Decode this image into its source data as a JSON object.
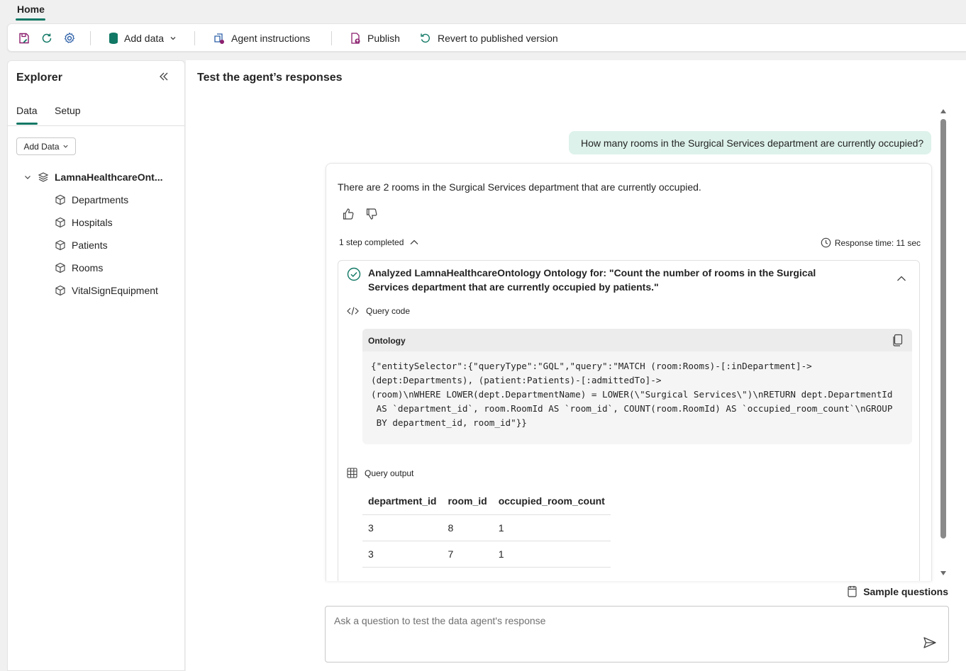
{
  "top_tab": {
    "label": "Home"
  },
  "toolbar": {
    "add_data_label": "Add data",
    "agent_instructions_label": "Agent instructions",
    "publish_label": "Publish",
    "revert_label": "Revert to published version"
  },
  "explorer": {
    "title": "Explorer",
    "tabs": [
      {
        "label": "Data"
      },
      {
        "label": "Setup"
      }
    ],
    "add_data_button": "Add Data",
    "tree_root": "LamnaHealthcareOnt...",
    "tree_items": [
      {
        "label": "Departments"
      },
      {
        "label": "Hospitals"
      },
      {
        "label": "Patients"
      },
      {
        "label": "Rooms"
      },
      {
        "label": "VitalSignEquipment"
      }
    ]
  },
  "main": {
    "title": "Test the agent’s responses",
    "user_message": "How many rooms in the Surgical Services department are currently occupied?",
    "response": {
      "text": "There are 2 rooms in the Surgical Services department that are currently occupied.",
      "steps_label": "1 step completed",
      "response_time": "Response time: 11 sec",
      "step": {
        "title": "Analyzed LamnaHealthcareOntology Ontology for: \"Count the number of rooms in the Surgical Services department that are currently occupied by patients.\"",
        "query_code_label": "Query code",
        "code_language": "Ontology",
        "code": "{\"entitySelector\":{\"queryType\":\"GQL\",\"query\":\"MATCH (room:Rooms)-[:inDepartment]->\n(dept:Departments), (patient:Patients)-[:admittedTo]->\n(room)\\nWHERE LOWER(dept.DepartmentName) = LOWER(\\\"Surgical Services\\\")\\nRETURN dept.DepartmentId\n AS `department_id`, room.RoomId AS `room_id`, COUNT(room.RoomId) AS `occupied_room_count`\\nGROUP\n BY department_id, room_id\"}}",
        "query_output_label": "Query output",
        "table": {
          "headers": [
            "department_id",
            "room_id",
            "occupied_room_count"
          ],
          "rows": [
            [
              "3",
              "8",
              "1"
            ],
            [
              "3",
              "7",
              "1"
            ]
          ]
        }
      }
    },
    "sample_questions_label": "Sample questions",
    "ask_placeholder": "Ask a question to test the data agent's response"
  },
  "colors": {
    "accent": "#117865",
    "user_bubble": "#ddf2ea",
    "publish_icon": "#8b1f6e"
  }
}
